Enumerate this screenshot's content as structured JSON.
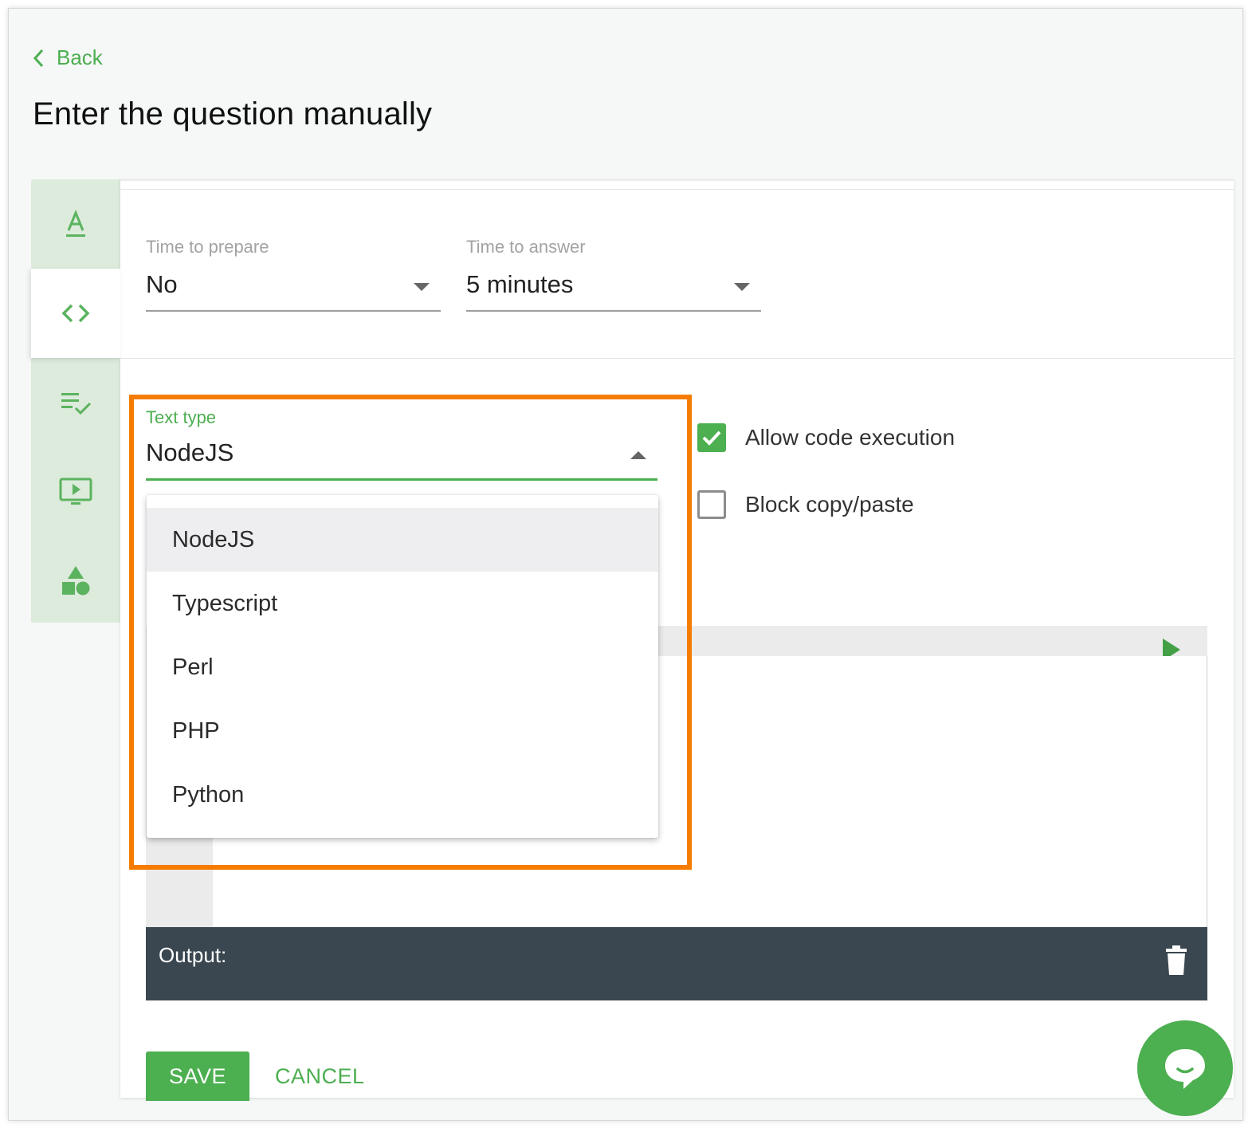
{
  "nav": {
    "back_label": "Back"
  },
  "page": {
    "title": "Enter the question manually"
  },
  "rail": {
    "tabs": [
      {
        "icon": "text-format-icon",
        "active": false
      },
      {
        "icon": "code-icon",
        "active": true
      },
      {
        "icon": "checklist-icon",
        "active": false
      },
      {
        "icon": "video-screen-icon",
        "active": false
      },
      {
        "icon": "shapes-icon",
        "active": false
      }
    ]
  },
  "timing": {
    "prepare_label": "Time to prepare",
    "prepare_value": "No",
    "answer_label": "Time to answer",
    "answer_value": "5 minutes"
  },
  "text_type": {
    "label": "Text type",
    "value": "NodeJS",
    "options": [
      "NodeJS",
      "Typescript",
      "Perl",
      "PHP",
      "Python"
    ],
    "selected_index": 0
  },
  "options": {
    "allow_code_execution": {
      "label": "Allow code execution",
      "checked": true
    },
    "block_copy_paste": {
      "label": "Block copy/paste",
      "checked": false
    }
  },
  "editor": {
    "output_label": "Output:"
  },
  "actions": {
    "save_label": "SAVE",
    "cancel_label": "CANCEL"
  },
  "colors": {
    "accent": "#4caf50",
    "highlight": "#f57c00",
    "output_bg": "#3a4750"
  }
}
